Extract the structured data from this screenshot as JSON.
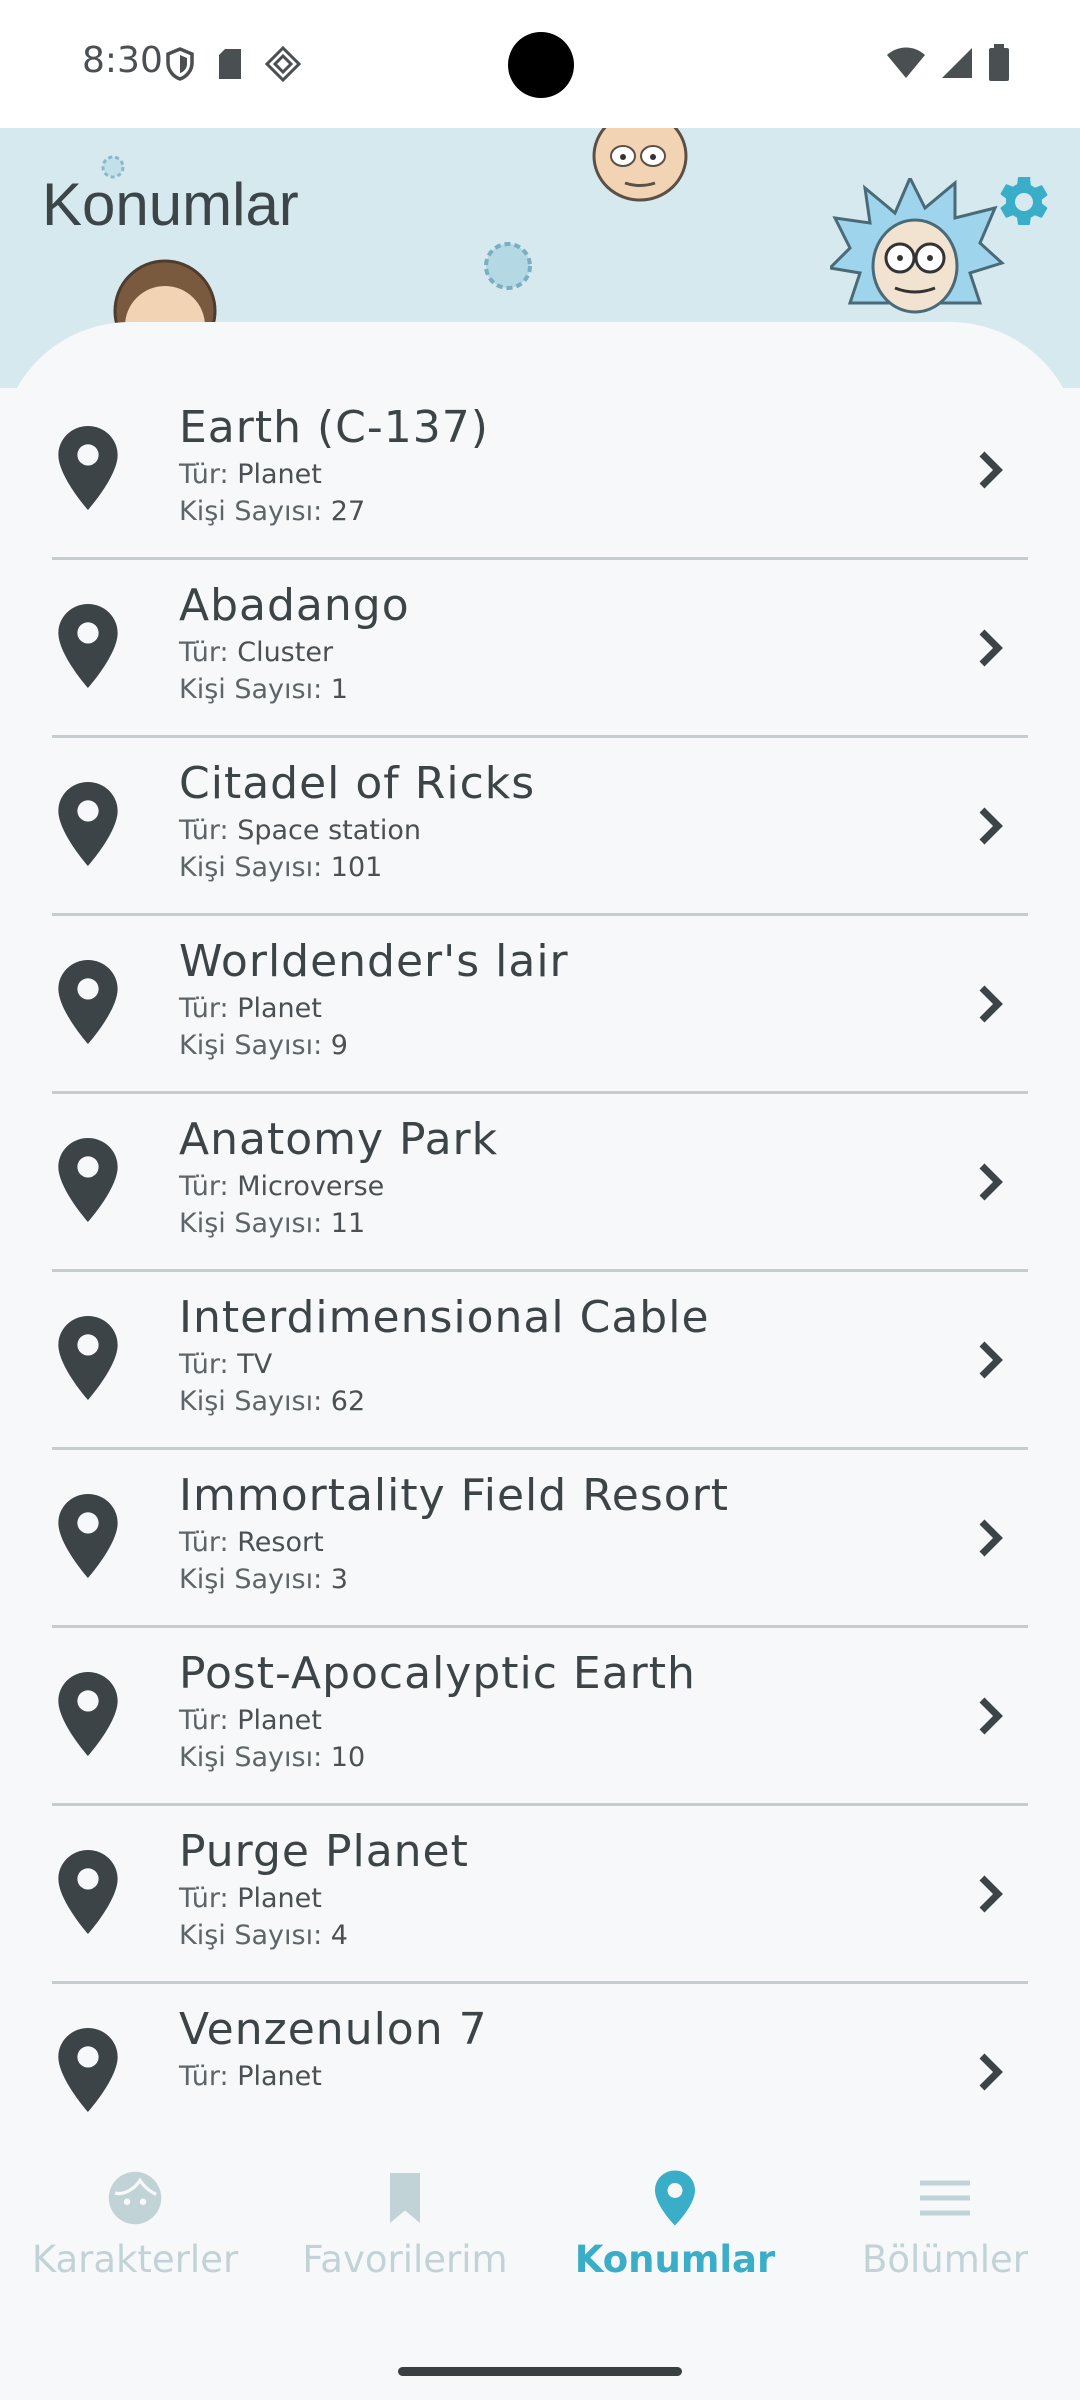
{
  "status_bar": {
    "time": "8:30"
  },
  "header": {
    "title": "Konumlar"
  },
  "labels": {
    "type": "Tür:",
    "count": "Kişi Sayısı:"
  },
  "locations": [
    {
      "name": "Earth (C-137)",
      "type": "Planet",
      "count": "27"
    },
    {
      "name": "Abadango",
      "type": "Cluster",
      "count": "1"
    },
    {
      "name": "Citadel of Ricks",
      "type": "Space station",
      "count": "101"
    },
    {
      "name": "Worldender's lair",
      "type": "Planet",
      "count": "9"
    },
    {
      "name": "Anatomy Park",
      "type": "Microverse",
      "count": "11"
    },
    {
      "name": "Interdimensional Cable",
      "type": "TV",
      "count": "62"
    },
    {
      "name": "Immortality Field Resort",
      "type": "Resort",
      "count": "3"
    },
    {
      "name": "Post-Apocalyptic Earth",
      "type": "Planet",
      "count": "10"
    },
    {
      "name": "Purge Planet",
      "type": "Planet",
      "count": "4"
    },
    {
      "name": "Venzenulon 7",
      "type": "Planet",
      "count": ""
    }
  ],
  "bottom_nav": {
    "items": [
      {
        "label": "Karakterler",
        "icon": "face-icon"
      },
      {
        "label": "Favorilerim",
        "icon": "bookmark-icon"
      },
      {
        "label": "Konumlar",
        "icon": "location-pin-icon"
      },
      {
        "label": "Bölümler",
        "icon": "menu-icon"
      }
    ],
    "active_index": 2
  },
  "colors": {
    "accent": "#3aaec8",
    "inactive": "#c2d3d8",
    "header_bg": "#d5e9ee",
    "pin": "#3d4447"
  }
}
